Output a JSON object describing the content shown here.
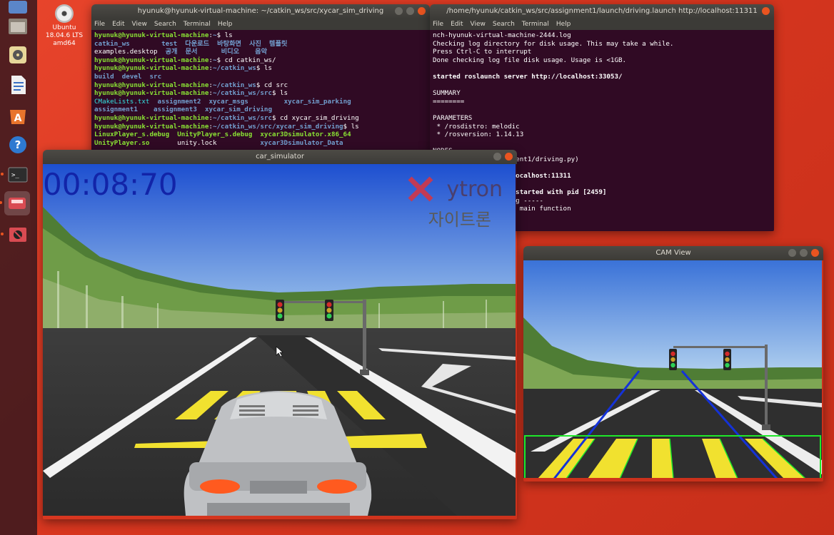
{
  "desktop": {
    "icon_label_1": "Ubuntu",
    "icon_label_2": "18.04.6 LTS",
    "icon_label_3": "amd64"
  },
  "menu": [
    "File",
    "Edit",
    "View",
    "Search",
    "Terminal",
    "Help"
  ],
  "terminal1": {
    "title": "hyunuk@hyunuk-virtual-machine: ~/catkin_ws/src/xycar_sim_driving",
    "lines": [
      [
        [
          "g",
          "hyunuk@hyunuk-virtual-machine"
        ],
        [
          "w",
          ":"
        ],
        [
          "b",
          "~"
        ],
        [
          "w",
          "$ ls"
        ]
      ],
      [
        [
          "b",
          "catkin_ws"
        ],
        [
          "w",
          "        "
        ],
        [
          "b",
          "test"
        ],
        [
          "w",
          "  "
        ],
        [
          "b",
          "다운로드"
        ],
        [
          "w",
          "  "
        ],
        [
          "b",
          "바탕화면"
        ],
        [
          "w",
          "  "
        ],
        [
          "b",
          "사진"
        ],
        [
          "w",
          "  "
        ],
        [
          "b",
          "템플릿"
        ]
      ],
      [
        [
          "w",
          "examples.desktop  "
        ],
        [
          "b",
          "공개"
        ],
        [
          "w",
          "  "
        ],
        [
          "b",
          "문서"
        ],
        [
          "w",
          "      "
        ],
        [
          "b",
          "비디오"
        ],
        [
          "w",
          "    "
        ],
        [
          "b",
          "음악"
        ]
      ],
      [
        [
          "g",
          "hyunuk@hyunuk-virtual-machine"
        ],
        [
          "w",
          ":"
        ],
        [
          "b",
          "~"
        ],
        [
          "w",
          "$ cd catkin_ws/"
        ]
      ],
      [
        [
          "g",
          "hyunuk@hyunuk-virtual-machine"
        ],
        [
          "w",
          ":"
        ],
        [
          "b",
          "~/catkin_ws"
        ],
        [
          "w",
          "$ ls"
        ]
      ],
      [
        [
          "b",
          "build"
        ],
        [
          "w",
          "  "
        ],
        [
          "b",
          "devel"
        ],
        [
          "w",
          "  "
        ],
        [
          "b",
          "src"
        ]
      ],
      [
        [
          "g",
          "hyunuk@hyunuk-virtual-machine"
        ],
        [
          "w",
          ":"
        ],
        [
          "b",
          "~/catkin_ws"
        ],
        [
          "w",
          "$ cd src"
        ]
      ],
      [
        [
          "g",
          "hyunuk@hyunuk-virtual-machine"
        ],
        [
          "w",
          ":"
        ],
        [
          "b",
          "~/catkin_ws/src"
        ],
        [
          "w",
          "$ ls"
        ]
      ],
      [
        [
          "c",
          "CMakeLists.txt"
        ],
        [
          "w",
          "  "
        ],
        [
          "b",
          "assignment2"
        ],
        [
          "w",
          "  "
        ],
        [
          "b",
          "xycar_msgs"
        ],
        [
          "w",
          "         "
        ],
        [
          "b",
          "xycar_sim_parking"
        ]
      ],
      [
        [
          "b",
          "assignment1"
        ],
        [
          "w",
          "    "
        ],
        [
          "b",
          "assignment3"
        ],
        [
          "w",
          "  "
        ],
        [
          "b",
          "xycar_sim_driving"
        ]
      ],
      [
        [
          "g",
          "hyunuk@hyunuk-virtual-machine"
        ],
        [
          "w",
          ":"
        ],
        [
          "b",
          "~/catkin_ws/src"
        ],
        [
          "w",
          "$ cd xycar_sim_driving"
        ]
      ],
      [
        [
          "g",
          "hyunuk@hyunuk-virtual-machine"
        ],
        [
          "w",
          ":"
        ],
        [
          "b",
          "~/catkin_ws/src/xycar_sim_driving"
        ],
        [
          "w",
          "$ ls"
        ]
      ],
      [
        [
          "g",
          "LinuxPlayer_s.debug"
        ],
        [
          "w",
          "  "
        ],
        [
          "g",
          "UnityPlayer_s.debug"
        ],
        [
          "w",
          "  "
        ],
        [
          "g",
          "xycar3Dsimulator.x86_64"
        ]
      ],
      [
        [
          "g",
          "UnityPlayer.so"
        ],
        [
          "w",
          "       unity.lock           "
        ],
        [
          "b",
          "xycar3Dsimulator_Data"
        ]
      ]
    ]
  },
  "terminal2": {
    "title": "/home/hyunuk/catkin_ws/src/assignment1/launch/driving.launch http://localhost:11311",
    "lines": [
      [
        [
          "w",
          "nch-hyunuk-virtual-machine-2444.log"
        ]
      ],
      [
        [
          "w",
          "Checking log directory for disk usage. This may take a while."
        ]
      ],
      [
        [
          "w",
          "Press Ctrl-C to interrupt"
        ]
      ],
      [
        [
          "w",
          "Done checking log file disk usage. Usage is <1GB."
        ]
      ],
      [
        [
          "w",
          ""
        ]
      ],
      [
        [
          "wb",
          "started roslaunch server http://localhost:33053/"
        ]
      ],
      [
        [
          "w",
          ""
        ]
      ],
      [
        [
          "w",
          "SUMMARY"
        ]
      ],
      [
        [
          "w",
          "========"
        ]
      ],
      [
        [
          "w",
          ""
        ]
      ],
      [
        [
          "w",
          "PARAMETERS"
        ]
      ],
      [
        [
          "w",
          " * /rosdistro: melodic"
        ]
      ],
      [
        [
          "w",
          " * /rosversion: 1.14.13"
        ]
      ],
      [
        [
          "w",
          ""
        ]
      ],
      [
        [
          "w",
          "NODES"
        ]
      ],
      [
        [
          "w",
          "                  gnment1/driving.py)"
        ]
      ],
      [
        [
          "w",
          ""
        ]
      ],
      [
        [
          "wb",
          "                  //localhost:11311"
        ]
      ],
      [
        [
          "w",
          ""
        ]
      ],
      [
        [
          "wb",
          "                  ]: started with pid [2459]"
        ]
      ],
      [
        [
          "w",
          "                  ving -----"
        ]
      ],
      [
        [
          "w",
          "                  art main function"
        ]
      ]
    ]
  },
  "simulator": {
    "title": "car_simulator",
    "timer": "00:08:70",
    "brand": "ytron",
    "brand_ko": "자이트론"
  },
  "cam": {
    "title": "CAM View"
  }
}
